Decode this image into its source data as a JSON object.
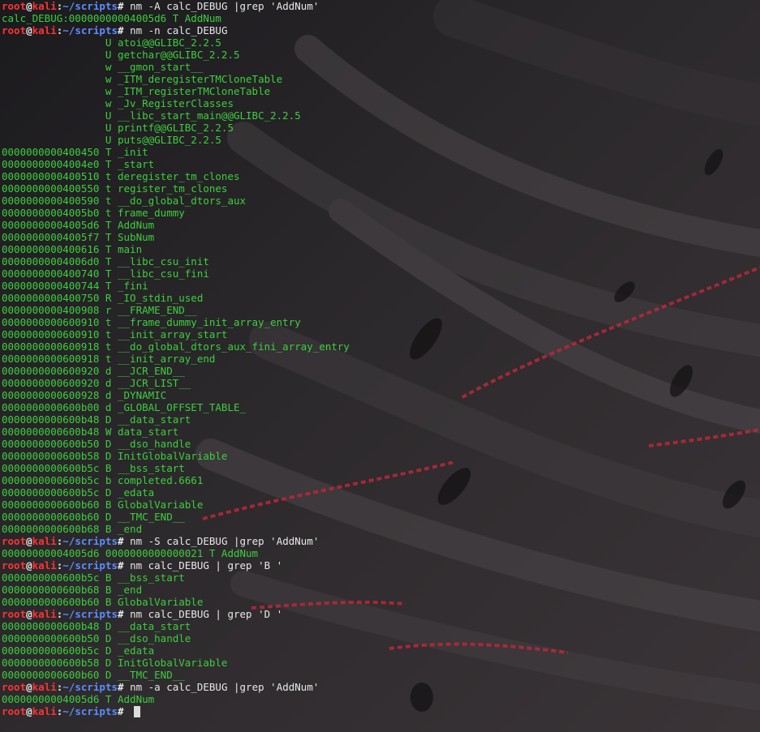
{
  "theme": {
    "user_color": "#ff3333",
    "path_color": "#5c8cff",
    "output_color": "#3ccf3c",
    "command_color": "#e8e8e8",
    "background_color": "#2a2629"
  },
  "prompt": {
    "user": "root",
    "at": "@",
    "host": "kali",
    "colon": ":",
    "cwd": "~/scripts",
    "symbol": "#"
  },
  "lines": [
    {
      "kind": "prompt",
      "text": " nm -A calc_DEBUG |grep 'AddNum'"
    },
    {
      "kind": "output",
      "text": "calc_DEBUG:00000000004005d6 T AddNum"
    },
    {
      "kind": "prompt",
      "text": " nm -n calc_DEBUG"
    },
    {
      "kind": "output",
      "text": "                 U atoi@@GLIBC_2.2.5"
    },
    {
      "kind": "output",
      "text": "                 U getchar@@GLIBC_2.2.5"
    },
    {
      "kind": "output",
      "text": "                 w __gmon_start__"
    },
    {
      "kind": "output",
      "text": "                 w _ITM_deregisterTMCloneTable"
    },
    {
      "kind": "output",
      "text": "                 w _ITM_registerTMCloneTable"
    },
    {
      "kind": "output",
      "text": "                 w _Jv_RegisterClasses"
    },
    {
      "kind": "output",
      "text": "                 U __libc_start_main@@GLIBC_2.2.5"
    },
    {
      "kind": "output",
      "text": "                 U printf@@GLIBC_2.2.5"
    },
    {
      "kind": "output",
      "text": "                 U puts@@GLIBC_2.2.5"
    },
    {
      "kind": "output",
      "text": "0000000000400450 T _init"
    },
    {
      "kind": "output",
      "text": "00000000004004e0 T _start"
    },
    {
      "kind": "output",
      "text": "0000000000400510 t deregister_tm_clones"
    },
    {
      "kind": "output",
      "text": "0000000000400550 t register_tm_clones"
    },
    {
      "kind": "output",
      "text": "0000000000400590 t __do_global_dtors_aux"
    },
    {
      "kind": "output",
      "text": "00000000004005b0 t frame_dummy"
    },
    {
      "kind": "output",
      "text": "00000000004005d6 T AddNum"
    },
    {
      "kind": "output",
      "text": "00000000004005f7 T SubNum"
    },
    {
      "kind": "output",
      "text": "0000000000400616 T main"
    },
    {
      "kind": "output",
      "text": "00000000004006d0 T __libc_csu_init"
    },
    {
      "kind": "output",
      "text": "0000000000400740 T __libc_csu_fini"
    },
    {
      "kind": "output",
      "text": "0000000000400744 T _fini"
    },
    {
      "kind": "output",
      "text": "0000000000400750 R _IO_stdin_used"
    },
    {
      "kind": "output",
      "text": "0000000000400908 r __FRAME_END__"
    },
    {
      "kind": "output",
      "text": "0000000000600910 t __frame_dummy_init_array_entry"
    },
    {
      "kind": "output",
      "text": "0000000000600910 t __init_array_start"
    },
    {
      "kind": "output",
      "text": "0000000000600918 t __do_global_dtors_aux_fini_array_entry"
    },
    {
      "kind": "output",
      "text": "0000000000600918 t __init_array_end"
    },
    {
      "kind": "output",
      "text": "0000000000600920 d __JCR_END__"
    },
    {
      "kind": "output",
      "text": "0000000000600920 d __JCR_LIST__"
    },
    {
      "kind": "output",
      "text": "0000000000600928 d _DYNAMIC"
    },
    {
      "kind": "output",
      "text": "0000000000600b00 d _GLOBAL_OFFSET_TABLE_"
    },
    {
      "kind": "output",
      "text": "0000000000600b48 D __data_start"
    },
    {
      "kind": "output",
      "text": "0000000000600b48 W data_start"
    },
    {
      "kind": "output",
      "text": "0000000000600b50 D __dso_handle"
    },
    {
      "kind": "output",
      "text": "0000000000600b58 D InitGlobalVariable"
    },
    {
      "kind": "output",
      "text": "0000000000600b5c B __bss_start"
    },
    {
      "kind": "output",
      "text": "0000000000600b5c b completed.6661"
    },
    {
      "kind": "output",
      "text": "0000000000600b5c D _edata"
    },
    {
      "kind": "output",
      "text": "0000000000600b60 B GlobalVariable"
    },
    {
      "kind": "output",
      "text": "0000000000600b60 D __TMC_END__"
    },
    {
      "kind": "output",
      "text": "0000000000600b68 B _end"
    },
    {
      "kind": "prompt",
      "text": " nm -S calc_DEBUG |grep 'AddNum'"
    },
    {
      "kind": "output",
      "text": "00000000004005d6 0000000000000021 T AddNum"
    },
    {
      "kind": "prompt",
      "text": " nm calc_DEBUG | grep 'B '"
    },
    {
      "kind": "output",
      "text": "0000000000600b5c B __bss_start"
    },
    {
      "kind": "output",
      "text": "0000000000600b68 B _end"
    },
    {
      "kind": "output",
      "text": "0000000000600b60 B GlobalVariable"
    },
    {
      "kind": "prompt",
      "text": " nm calc_DEBUG | grep 'D '"
    },
    {
      "kind": "output",
      "text": "0000000000600b48 D __data_start"
    },
    {
      "kind": "output",
      "text": "0000000000600b50 D __dso_handle"
    },
    {
      "kind": "output",
      "text": "0000000000600b5c D _edata"
    },
    {
      "kind": "output",
      "text": "0000000000600b58 D InitGlobalVariable"
    },
    {
      "kind": "output",
      "text": "0000000000600b60 D __TMC_END__"
    },
    {
      "kind": "prompt",
      "text": " nm -a calc_DEBUG |grep 'AddNum'"
    },
    {
      "kind": "output",
      "text": "00000000004005d6 T AddNum"
    },
    {
      "kind": "prompt",
      "text": " ",
      "cursor": true
    }
  ]
}
